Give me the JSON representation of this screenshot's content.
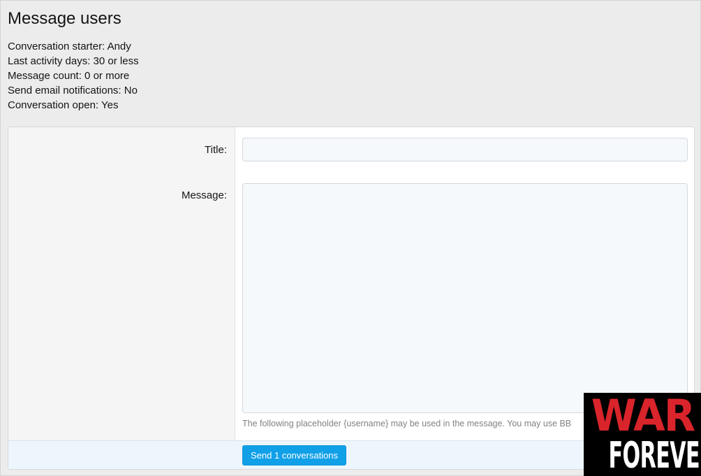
{
  "page": {
    "title": "Message users"
  },
  "criteria": [
    "Conversation starter: Andy",
    "Last activity days: 30 or less",
    "Message count: 0 or more",
    "Send email notifications: No",
    "Conversation open: Yes"
  ],
  "form": {
    "title_label": "Title:",
    "title_value": "",
    "message_label": "Message:",
    "message_value": "",
    "hint": "The following placeholder {username} may be used in the message. You may use BB",
    "send_label": "Send 1 conversations"
  },
  "watermark": {
    "line1": "WAR",
    "line2": "FOREVER"
  },
  "colors": {
    "accent": "#10a0e8",
    "background": "#ececec",
    "watermark_red": "#d9242b"
  }
}
